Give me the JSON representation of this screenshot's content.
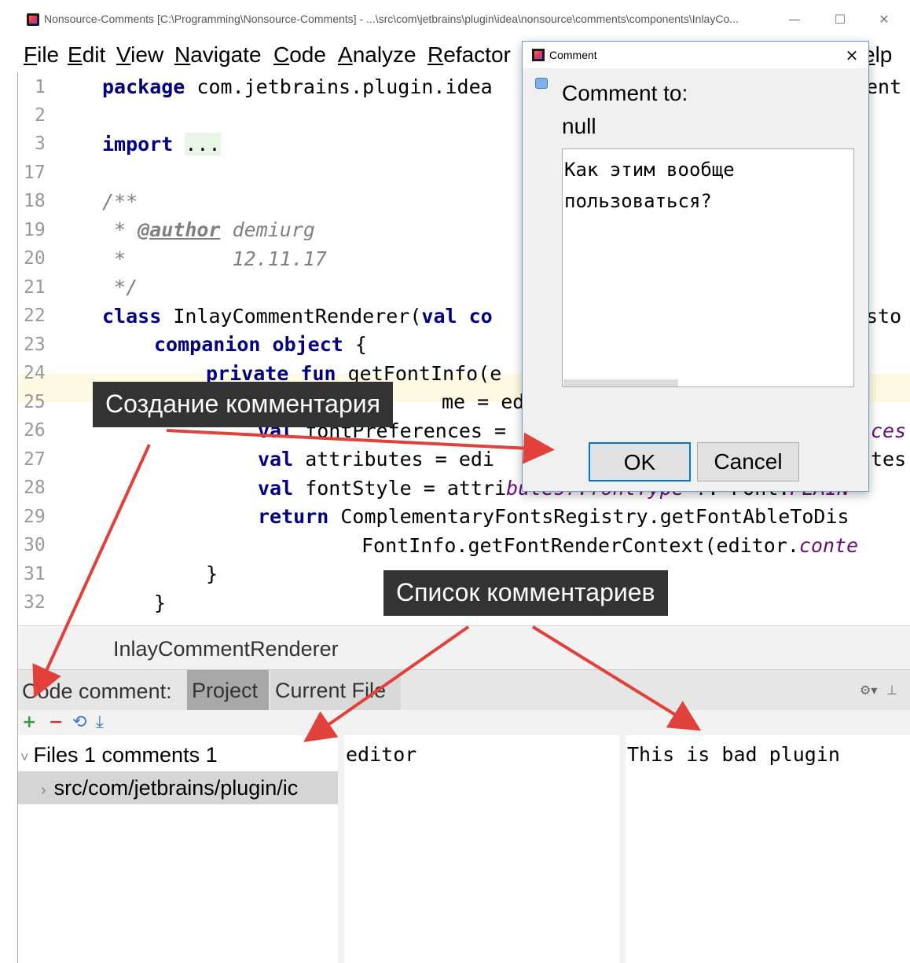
{
  "window": {
    "title": "Nonsource-Comments [C:\\Programming\\Nonsource-Comments] - ...\\src\\com\\jetbrains\\plugin\\idea\\nonsource\\comments\\components\\InlayCo...",
    "minimize": "—",
    "maximize": "☐",
    "close": "✕"
  },
  "menu": [
    "File",
    "Edit",
    "View",
    "Navigate",
    "Code",
    "Analyze",
    "Refactor",
    "elp"
  ],
  "editor": {
    "lines": [
      {
        "n": "1"
      },
      {
        "n": "2"
      },
      {
        "n": "3"
      },
      {
        "n": "17"
      },
      {
        "n": "18"
      },
      {
        "n": "19"
      },
      {
        "n": "20"
      },
      {
        "n": "21"
      },
      {
        "n": "22"
      },
      {
        "n": "23"
      },
      {
        "n": "24"
      },
      {
        "n": "25"
      },
      {
        "n": "26"
      },
      {
        "n": "27"
      },
      {
        "n": "28"
      },
      {
        "n": "29"
      },
      {
        "n": "30"
      },
      {
        "n": "31"
      },
      {
        "n": "32"
      }
    ],
    "code": {
      "l1_kw": "package",
      "l1_rest": " com.jetbrains.plugin.idea",
      "l1_tail": "ent",
      "l3_kw": "import",
      "l3_fold": "...",
      "l18": "/**",
      "l19_star": " * ",
      "l19_tag": "@author",
      "l19_name": " demiurg",
      "l20": " *         12.11.17",
      "l21": " */",
      "l22_kw": "class",
      "l22_rest": " InlayCommentRenderer(",
      "l22_val": "val",
      "l22_c": " co",
      "l22_tail": "sto",
      "l23_kw": "companion object",
      "l23_rest": " {",
      "l24_kw": "private fun",
      "l24_rest": " getFontInfo(e",
      "l25_rest": "me = ed",
      "l26_kw": "val",
      "l26_rest": " fontPreferences =",
      "l26_tail": "ces",
      "l27_kw": "val",
      "l27_rest": " attributes = edi",
      "l27_tail": "tes",
      "l28_kw": "val",
      "l28_rest": " fontStyle = attri",
      "l28_p": "butes?.fontType",
      "l28_rest2": " ?: Font.",
      "l28_tail": "PLAIN",
      "l29_kw": "return",
      "l29_rest": " ComplementaryFontsRegistry.getFontAbleToDis",
      "l30_rest": "FontInfo.getFontRenderContext(editor.",
      "l30_tail": "conte",
      "l31": "}",
      "l32": "}"
    }
  },
  "breadcrumb": "InlayCommentRenderer",
  "toolwindow": {
    "label": "Code comment:",
    "tabs": [
      "Project",
      "Current File"
    ],
    "toolbar": {
      "add": "+",
      "remove": "−",
      "refresh": "⟲",
      "export": "⤓"
    },
    "header_icons": {
      "settings": "⚙▾",
      "pin": "⊥"
    },
    "tree": {
      "root": "Files 1 comments 1",
      "child": "src/com/jetbrains/plugin/ic"
    },
    "middle_text": "editor",
    "right_text": "This is bad plugin"
  },
  "dialog": {
    "title": "Comment",
    "close": "×",
    "label": "Comment to:",
    "target": "null",
    "text": "Как этим вообще\nпользоваться?",
    "ok": "OK",
    "cancel": "Cancel"
  },
  "callouts": {
    "create": "Создание комментария",
    "list": "Список комментариев"
  },
  "colors": {
    "keyword": "#000080",
    "comment": "#808080",
    "arrow": "#e0413a",
    "callout_bg": "#333333"
  }
}
